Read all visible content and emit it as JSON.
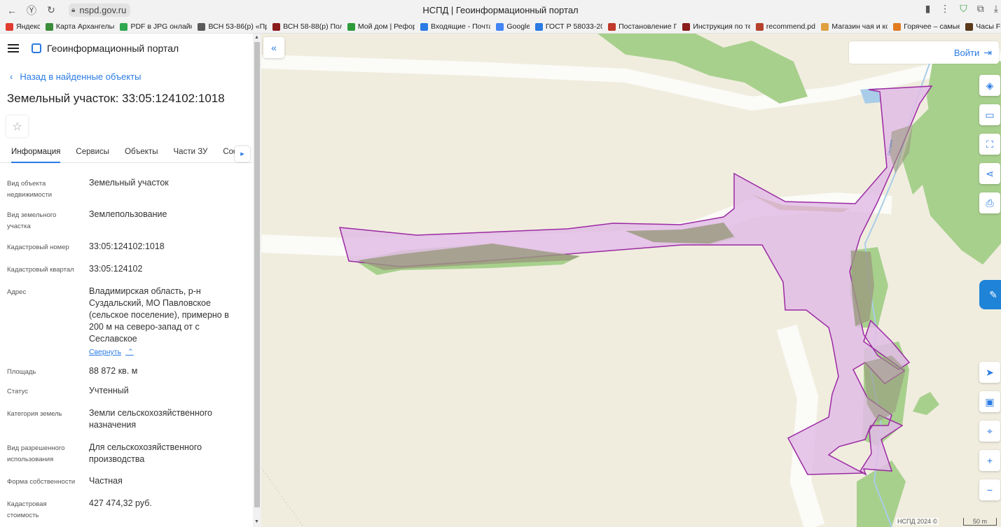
{
  "browser": {
    "url": "nspd.gov.ru",
    "tab_title": "НСПД | Геоинформационный портал",
    "bookmarks": [
      {
        "label": "Яндекс",
        "color": "#e03c31"
      },
      {
        "label": "Карта Архангельс",
        "color": "#3b8d3b"
      },
      {
        "label": "PDF в JPG онлайн",
        "color": "#2fa84f"
      },
      {
        "label": "ВСН 53-86(р) «Пр",
        "color": "#5a5a5a"
      },
      {
        "label": "ВСН 58-88(р) Пол",
        "color": "#8b1c1c"
      },
      {
        "label": "Мой дом | Рефор",
        "color": "#2d9b3a"
      },
      {
        "label": "Входящие - Почта",
        "color": "#2a7be4"
      },
      {
        "label": "Google",
        "color": "#4285f4"
      },
      {
        "label": "ГОСТ Р 58033-20",
        "color": "#2a7be4"
      },
      {
        "label": "Постановление П",
        "color": "#c0392b"
      },
      {
        "label": "Инструкция по те",
        "color": "#8b1c1c"
      },
      {
        "label": "recommend.pdf",
        "color": "#b5422e"
      },
      {
        "label": "Магазин чая и ко",
        "color": "#e0a040"
      },
      {
        "label": "Горячее – самые",
        "color": "#e07b20"
      },
      {
        "label": "Часы Fi",
        "color": "#5a3a1a"
      }
    ]
  },
  "panel": {
    "brand": "Геоинформационный портал",
    "back_label": "Назад в найденные объекты",
    "title": "Земельный участок: 33:05:124102:1018",
    "tabs": [
      "Информация",
      "Сервисы",
      "Объекты",
      "Части ЗУ",
      "Соста"
    ],
    "properties": [
      {
        "label": "Вид объекта недвижимости",
        "value": "Земельный участок"
      },
      {
        "label": "Вид земельного участка",
        "value": "Землепользование"
      },
      {
        "label": "Кадастровый номер",
        "value": "33:05:124102:1018"
      },
      {
        "label": "Кадастровый квартал",
        "value": "33:05:124102"
      },
      {
        "label": "Адрес",
        "value": "Владимирская область, р-н Суздальский, МО Павловское (сельское поселение), примерно в 200 м на северо-запад от с Сеславское"
      },
      {
        "label": "Площадь",
        "value": "88 872 кв. м"
      },
      {
        "label": "Статус",
        "value": "Учтенный"
      },
      {
        "label": "Категория земель",
        "value": "Земли сельскохозяйственного назначения"
      },
      {
        "label": "Вид разрешенного использования",
        "value": "Для сельскохозяйственного производства"
      },
      {
        "label": "Форма собственности",
        "value": "Частная"
      },
      {
        "label": "Кадастровая стоимость",
        "value": "427 474,32 руб."
      }
    ],
    "collapse_label": "Свернуть"
  },
  "map": {
    "login_label": "Войти",
    "attribution": "НСПД 2024 ©",
    "scale_label": "50 m",
    "river_label": "Сеславка",
    "colors": {
      "background": "#f0eddf",
      "forest": "#a8d08d",
      "parcel_fill": "#e2bce6",
      "parcel_stroke": "#9b2aa3",
      "water": "#a9cde8",
      "accent": "#2a7be4"
    }
  }
}
